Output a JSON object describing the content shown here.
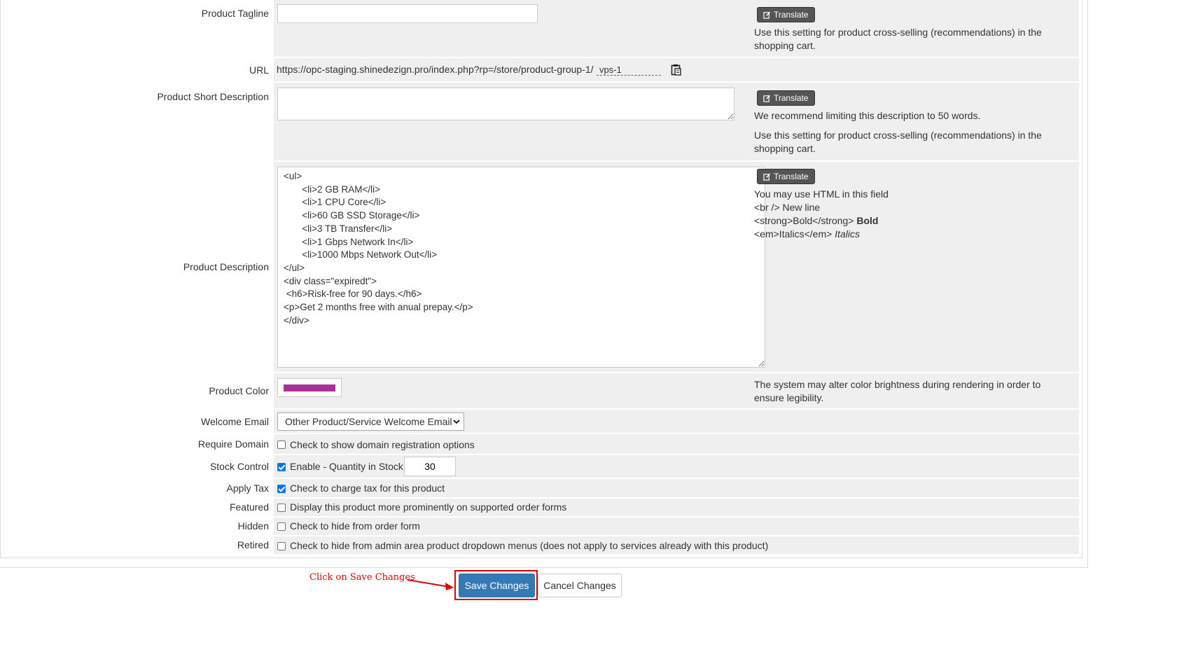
{
  "translate_label": "Translate",
  "tagline": {
    "label": "Product Tagline",
    "value": "",
    "help": "Use this setting for product cross-selling (recommendations) in the shopping cart."
  },
  "url": {
    "label": "URL",
    "prefix": "https://opc-staging.shinedezign.pro/index.php?rp=/store/product-group-1/",
    "slug": "vps-1",
    "copy_icon": "clipboard-icon"
  },
  "short_desc": {
    "label": "Product Short Description",
    "value": "",
    "help1": "We recommend limiting this description to 50 words.",
    "help2": "Use this setting for product cross-selling (recommendations) in the shopping cart."
  },
  "description": {
    "label": "Product Description",
    "value": "<ul>\n       <li>2 GB RAM</li>\n       <li>1 CPU Core</li>\n       <li>60 GB SSD Storage</li>\n       <li>3 TB Transfer</li>\n       <li>1 Gbps Network In</li>\n       <li>1000 Mbps Network Out</li>\n</ul>\n<div class=\"expiredt\">\n <h6>Risk-free for 90 days.</h6>\n<p>Get 2 months free with anual prepay.</p>\n</div>",
    "help_intro": "You may use HTML in this field",
    "help_br_code": "<br /> New line",
    "help_strong_code": "<strong>Bold</strong>",
    "help_strong_demo": "Bold",
    "help_em_code": "<em>Italics</em>",
    "help_em_demo": "Italics"
  },
  "color": {
    "label": "Product Color",
    "value": "#a83295",
    "help": "The system may alter color brightness during rendering in order to ensure legibility."
  },
  "welcome_email": {
    "label": "Welcome Email",
    "selected": "Other Product/Service Welcome Email"
  },
  "require_domain": {
    "label": "Require Domain",
    "text": "Check to show domain registration options",
    "checked": false
  },
  "stock_control": {
    "label": "Stock Control",
    "text": "Enable - Quantity in Stock:",
    "checked": true,
    "quantity": "30"
  },
  "apply_tax": {
    "label": "Apply Tax",
    "text": "Check to charge tax for this product",
    "checked": true
  },
  "featured": {
    "label": "Featured",
    "text": "Display this product more prominently on supported order forms",
    "checked": false
  },
  "hidden": {
    "label": "Hidden",
    "text": "Check to hide from order form",
    "checked": false
  },
  "retired": {
    "label": "Retired",
    "text": "Check to hide from admin area product dropdown menus (does not apply to services already with this product)",
    "checked": false
  },
  "annotation": {
    "text": "Click on Save Changes",
    "color": "#e00000"
  },
  "buttons": {
    "save": "Save Changes",
    "cancel": "Cancel Changes",
    "save_color": "#337ab7"
  }
}
